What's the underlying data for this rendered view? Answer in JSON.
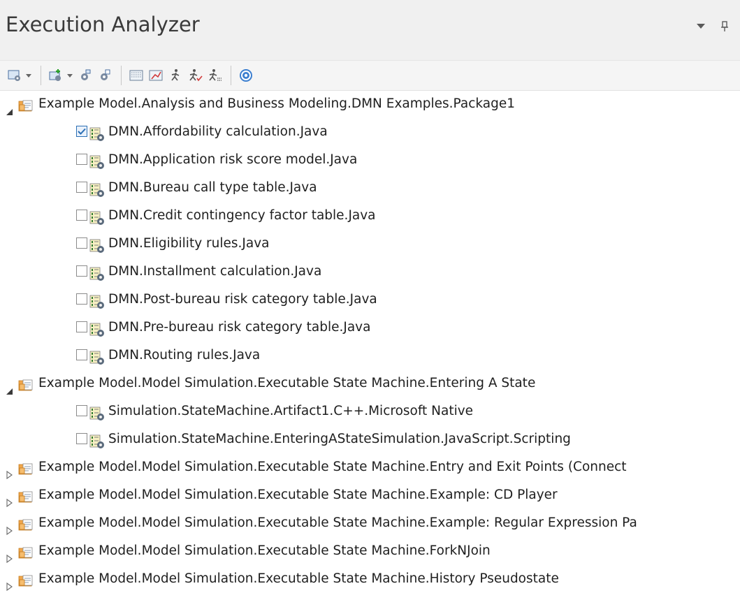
{
  "window": {
    "title": "Execution Analyzer"
  },
  "icons": {
    "menu": "chevron-down-icon",
    "pin": "pin-icon",
    "help": "help-icon"
  },
  "colors": {
    "package_folder": "#f0a64a",
    "checkbox_checked": "#2b6fb5",
    "help_circle": "#3c7fd0"
  },
  "tree": [
    {
      "type": "package",
      "expanded": true,
      "label": "Example Model.Analysis and Business Modeling.DMN Examples.Package1",
      "children": [
        {
          "label": "DMN.Affordability calculation.Java",
          "checked": true
        },
        {
          "label": "DMN.Application risk score model.Java",
          "checked": false
        },
        {
          "label": "DMN.Bureau call type table.Java",
          "checked": false
        },
        {
          "label": "DMN.Credit contingency factor table.Java",
          "checked": false
        },
        {
          "label": "DMN.Eligibility rules.Java",
          "checked": false
        },
        {
          "label": "DMN.Installment calculation.Java",
          "checked": false
        },
        {
          "label": "DMN.Post-bureau risk category table.Java",
          "checked": false
        },
        {
          "label": "DMN.Pre-bureau risk category table.Java",
          "checked": false
        },
        {
          "label": "DMN.Routing rules.Java",
          "checked": false
        }
      ]
    },
    {
      "type": "package",
      "expanded": true,
      "label": "Example Model.Model Simulation.Executable State Machine.Entering A State",
      "children": [
        {
          "label": "Simulation.StateMachine.Artifact1.C++.Microsoft Native",
          "checked": false
        },
        {
          "label": "Simulation.StateMachine.EnteringAStateSimulation.JavaScript.Scripting",
          "checked": false
        }
      ]
    },
    {
      "type": "package",
      "expanded": false,
      "label": "Example Model.Model Simulation.Executable State Machine.Entry and Exit Points (Connect",
      "children": []
    },
    {
      "type": "package",
      "expanded": false,
      "label": "Example Model.Model Simulation.Executable State Machine.Example: CD Player",
      "children": []
    },
    {
      "type": "package",
      "expanded": false,
      "label": "Example Model.Model Simulation.Executable State Machine.Example: Regular Expression Pa",
      "children": []
    },
    {
      "type": "package",
      "expanded": false,
      "label": "Example Model.Model Simulation.Executable State Machine.ForkNJoin",
      "children": []
    },
    {
      "type": "package",
      "expanded": false,
      "label": "Example Model.Model Simulation.Executable State Machine.History Pseudostate",
      "children": []
    }
  ]
}
